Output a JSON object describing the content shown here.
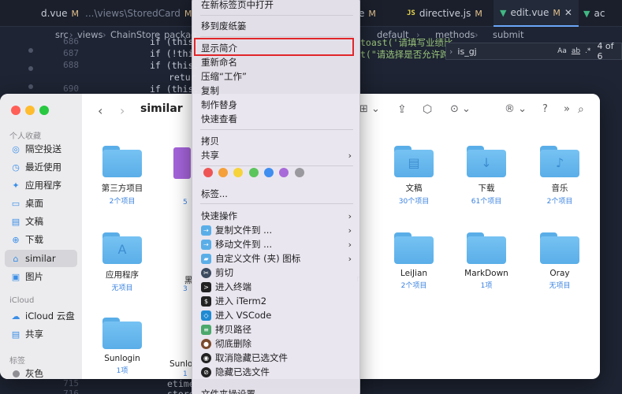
{
  "editor": {
    "tabs": [
      {
        "name": "d.vue",
        "suffix": "M",
        "prefix": "",
        "type": "vue"
      },
      {
        "name": "...\\views\\StoredCard",
        "suffix": "M",
        "prefix": "",
        "type": "path"
      },
      {
        "name": "e",
        "suffix": "M",
        "prefix": "",
        "type": "vue"
      },
      {
        "name": "directive.js",
        "suffix": "M",
        "prefix": "JS",
        "type": "js"
      },
      {
        "name": "edit.vue",
        "suffix": "M",
        "prefix": "",
        "type": "vue"
      },
      {
        "name": "ac",
        "suffix": "",
        "prefix": "",
        "type": "vue"
      }
    ],
    "breadcrumb": [
      "src",
      "views",
      "ChainStore",
      "packag",
      "default",
      "methods",
      "submit"
    ],
    "lines": [
      {
        "num": "686",
        "code": "if (this."
      },
      {
        "num": "687",
        "code": "if (!this"
      },
      {
        "num": "688",
        "code": "if (this."
      },
      {
        "num": "",
        "code": "retur"
      },
      {
        "num": "690",
        "code": "if (this."
      },
      {
        "num": "715",
        "code": "etime"
      },
      {
        "num": "716",
        "code": "store"
      }
    ],
    "code_right_1": "toast('请填写业绩比",
    "code_right_2": "t(\"请选择是否允许跨",
    "find": {
      "query": "is_gj",
      "aa": "Aa",
      "ab": "ab",
      "star": ".*",
      "count": "4 of 6"
    }
  },
  "finder": {
    "title": "similar",
    "sidebar": {
      "favorites_header": "个人收藏",
      "items": [
        {
          "label": "隔空投送",
          "icon": "airdrop-icon",
          "glyph": "◎"
        },
        {
          "label": "最近使用",
          "icon": "clock-icon",
          "glyph": "◷"
        },
        {
          "label": "应用程序",
          "icon": "apps-icon",
          "glyph": "✦"
        },
        {
          "label": "桌面",
          "icon": "desktop-icon",
          "glyph": "▭"
        },
        {
          "label": "文稿",
          "icon": "document-icon",
          "glyph": "▤"
        },
        {
          "label": "下载",
          "icon": "download-icon",
          "glyph": "⊕"
        },
        {
          "label": "similar",
          "icon": "home-icon",
          "glyph": "⌂"
        },
        {
          "label": "图片",
          "icon": "pictures-icon",
          "glyph": "▣"
        }
      ],
      "icloud_header": "iCloud",
      "icloud_items": [
        {
          "label": "iCloud 云盘",
          "icon": "cloud-icon",
          "glyph": "☁"
        },
        {
          "label": "共享",
          "icon": "shared-folder-icon",
          "glyph": "▤"
        }
      ],
      "tags_header": "标签",
      "tag_items": [
        {
          "label": "灰色",
          "color": "#8e8e93"
        }
      ]
    },
    "items": [
      {
        "name": "第三方项目",
        "count": "2个项目",
        "glyph": ""
      },
      {
        "name": "文稿",
        "count": "30个项目",
        "glyph": "▤"
      },
      {
        "name": "下载",
        "count": "61个项目",
        "glyph": "↓"
      },
      {
        "name": "音乐",
        "count": "2个项目",
        "glyph": "♪"
      },
      {
        "name": "应用程序",
        "count": "无项目",
        "glyph": "A"
      },
      {
        "name": "LeiJian",
        "count": "2个项目",
        "glyph": ""
      },
      {
        "name": "MarkDown",
        "count": "1项",
        "glyph": ""
      },
      {
        "name": "Oray",
        "count": "无项目",
        "glyph": ""
      },
      {
        "name": "Sunlogin",
        "count": "1项",
        "glyph": ""
      }
    ],
    "partial_names": {
      "second_col_1": "5",
      "second_col_2": "黑",
      "second_col_2_count": "3",
      "second_col_3": "Sunlo",
      "second_col_3_count": "1",
      "right_cut": "r"
    }
  },
  "menu": {
    "items": [
      {
        "label": "在新标签页中打开",
        "arrow": false
      },
      {
        "label": "移到废纸篓",
        "arrow": false
      },
      {
        "label": "显示简介",
        "arrow": false,
        "highlighted": true
      },
      {
        "label": "重新命名",
        "arrow": false
      },
      {
        "label": "压缩“工作”",
        "arrow": false
      },
      {
        "label": "复制",
        "arrow": false
      },
      {
        "label": "制作替身",
        "arrow": false
      },
      {
        "label": "快速查看",
        "arrow": false
      },
      {
        "label": "拷贝",
        "arrow": false
      },
      {
        "label": "共享",
        "arrow": true
      },
      {
        "label": "标签...",
        "arrow": false
      },
      {
        "label": "快速操作",
        "arrow": true
      },
      {
        "label": "复制文件到 ...",
        "arrow": true,
        "icon": "copy-to-icon",
        "color": "#5aaee8"
      },
      {
        "label": "移动文件到 ...",
        "arrow": true,
        "icon": "move-to-icon",
        "color": "#5aaee8"
      },
      {
        "label": "自定义文件 (夹) 图标",
        "arrow": true,
        "icon": "custom-icon-icon",
        "color": "#5aaee8"
      },
      {
        "label": "剪切",
        "arrow": false,
        "icon": "scissors-icon",
        "color": "#3b4a5e"
      },
      {
        "label": "进入终端",
        "arrow": false,
        "icon": "terminal-icon",
        "color": "#222222"
      },
      {
        "label": "进入 iTerm2",
        "arrow": false,
        "icon": "iterm-icon",
        "color": "#222222"
      },
      {
        "label": "进入 VSCode",
        "arrow": false,
        "icon": "vscode-icon",
        "color": "#1f8ad2"
      },
      {
        "label": "拷贝路径",
        "arrow": false,
        "icon": "copy-path-icon",
        "color": "#4aa86b"
      },
      {
        "label": "彻底删除",
        "arrow": false,
        "icon": "delete-icon",
        "color": "#7a4a2c"
      },
      {
        "label": "取消隐藏已选文件",
        "arrow": false,
        "icon": "eye-icon",
        "color": "#222222"
      },
      {
        "label": "隐藏已选文件",
        "arrow": false,
        "icon": "eye-slash-icon",
        "color": "#222222"
      },
      {
        "label": "文件夹操设置",
        "arrow": false
      }
    ],
    "tag_colors": [
      "#ee5454",
      "#f5a03a",
      "#f6d33b",
      "#5cc55c",
      "#3f8ef0",
      "#a86ad8",
      "#9a9a9e"
    ]
  },
  "watermark": "知乎 @鄢云峰"
}
